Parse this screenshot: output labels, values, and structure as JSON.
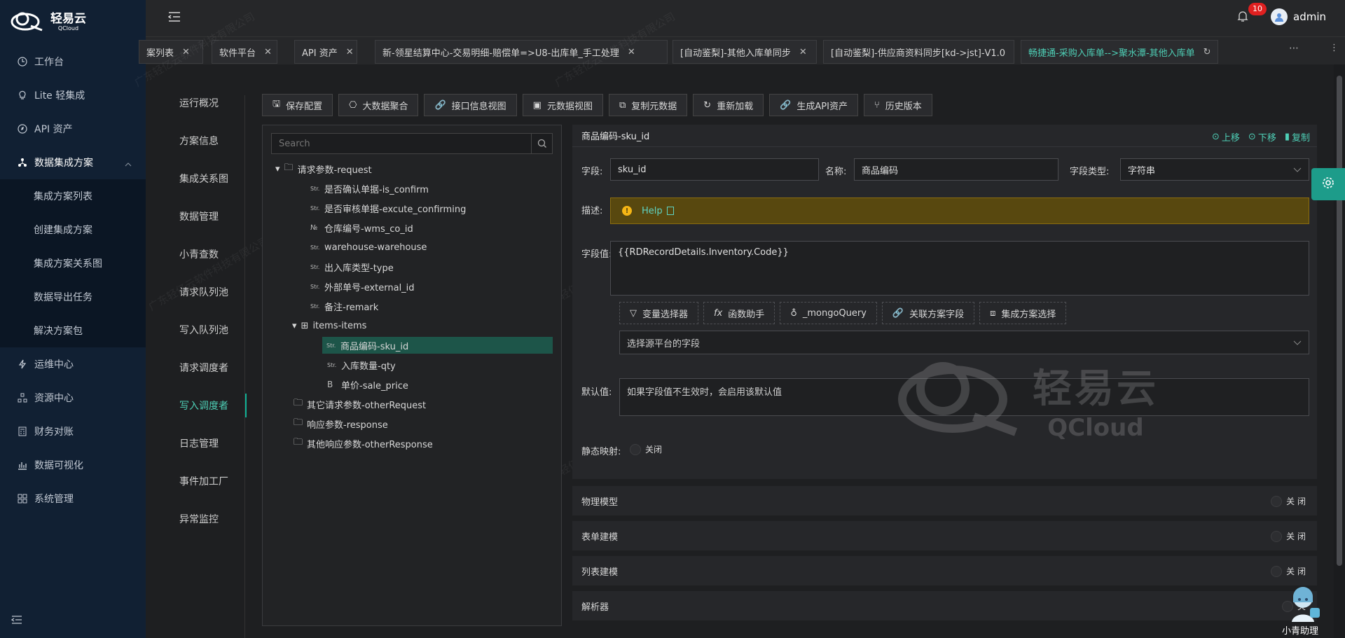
{
  "brand": {
    "name": "轻易云",
    "sub": "QCloud"
  },
  "sidebar": {
    "items": [
      {
        "label": "工作台",
        "icon": "clock-icon"
      },
      {
        "label": "Lite 轻集成",
        "icon": "bulb-icon"
      },
      {
        "label": "API 资产",
        "icon": "compass-icon"
      },
      {
        "label": "数据集成方案",
        "icon": "share-icon"
      },
      {
        "label": "运维中心",
        "icon": "bolt-icon"
      },
      {
        "label": "资源中心",
        "icon": "resource-icon"
      },
      {
        "label": "财务对账",
        "icon": "calculator-icon"
      },
      {
        "label": "数据可视化",
        "icon": "chart-icon"
      },
      {
        "label": "系统管理",
        "icon": "grid-icon"
      }
    ],
    "submenu": [
      "集成方案列表",
      "创建集成方案",
      "集成方案关系图",
      "数据导出任务",
      "解决方案包"
    ]
  },
  "header": {
    "notification_count": "10",
    "username": "admin"
  },
  "tabs": [
    {
      "label": "案列表"
    },
    {
      "label": "软件平台"
    },
    {
      "label": "API 资产"
    },
    {
      "label": "新-领星结算中心-交易明细-赔偿单=>U8-出库单_手工处理"
    },
    {
      "label": "[自动鉴梨]-其他入库单同步"
    },
    {
      "label": "[自动鉴梨]-供应商资料同步[kd->jst]-V1.0"
    },
    {
      "label": "畅捷通-采购入库单-->聚水潭-其他入库单"
    }
  ],
  "leftnav": [
    "运行概况",
    "方案信息",
    "集成关系图",
    "数据管理",
    "小青查数",
    "请求队列池",
    "写入队列池",
    "请求调度者",
    "写入调度者",
    "日志管理",
    "事件加工厂",
    "异常监控"
  ],
  "toolbar": [
    "保存配置",
    "大数据聚合",
    "接口信息视图",
    "元数据视图",
    "复制元数据",
    "重新加载",
    "生成API资产",
    "历史版本"
  ],
  "tree": {
    "search_placeholder": "Search",
    "nodes": [
      {
        "label": "请求参数-request",
        "type": "folder"
      },
      {
        "label": "是否确认单据-is_confirm",
        "type": "str"
      },
      {
        "label": "是否审核单据-excute_confirming",
        "type": "str"
      },
      {
        "label": "仓库编号-wms_co_id",
        "type": "num"
      },
      {
        "label": "warehouse-warehouse",
        "type": "str"
      },
      {
        "label": "出入库类型-type",
        "type": "str"
      },
      {
        "label": "外部单号-external_id",
        "type": "str"
      },
      {
        "label": "备注-remark",
        "type": "str"
      },
      {
        "label": "items-items",
        "type": "table"
      },
      {
        "label": "商品编码-sku_id",
        "type": "str"
      },
      {
        "label": "入库数量-qty",
        "type": "str"
      },
      {
        "label": "单价-sale_price",
        "type": "bool"
      },
      {
        "label": "其它请求参数-otherRequest",
        "type": "folder"
      },
      {
        "label": "响应参数-response",
        "type": "folder"
      },
      {
        "label": "其他响应参数-otherResponse",
        "type": "folder"
      }
    ]
  },
  "detail": {
    "title": "商品编码-sku_id",
    "actions": {
      "up": "上移",
      "down": "下移",
      "copy": "复制"
    },
    "field_label": "字段:",
    "field_value": "sku_id",
    "name_label": "名称:",
    "name_value": "商品编码",
    "type_label": "字段类型:",
    "type_value": "字符串",
    "desc_label": "描述:",
    "help": "Help",
    "value_label": "字段值:",
    "value": "{{RDRecordDetails.Inventory.Code}}",
    "buttons": [
      "变量选择器",
      "函数助手",
      "_mongoQuery",
      "关联方案字段",
      "集成方案选择"
    ],
    "source_placeholder": "选择源平台的字段",
    "default_label": "默认值:",
    "default_placeholder": "如果字段值不生效时，会启用该默认值",
    "static_label": "静态映射:",
    "static_toggle": "关闭"
  },
  "sections": [
    {
      "label": "物理模型",
      "toggle": "关 闭"
    },
    {
      "label": "表单建模",
      "toggle": "关 闭"
    },
    {
      "label": "列表建模",
      "toggle": "关 闭"
    },
    {
      "label": "解析器",
      "toggle": "关"
    }
  ],
  "watermark": {
    "main": "轻易云",
    "sub": "QCloud",
    "repeat": "广东轻亿云软件科技有限公司"
  },
  "assistant": {
    "label": "小青助理"
  },
  "colors": {
    "accent": "#0fb296",
    "sidebar": "#112033",
    "highlight": "#1d5549",
    "help_bg": "#58480f"
  }
}
